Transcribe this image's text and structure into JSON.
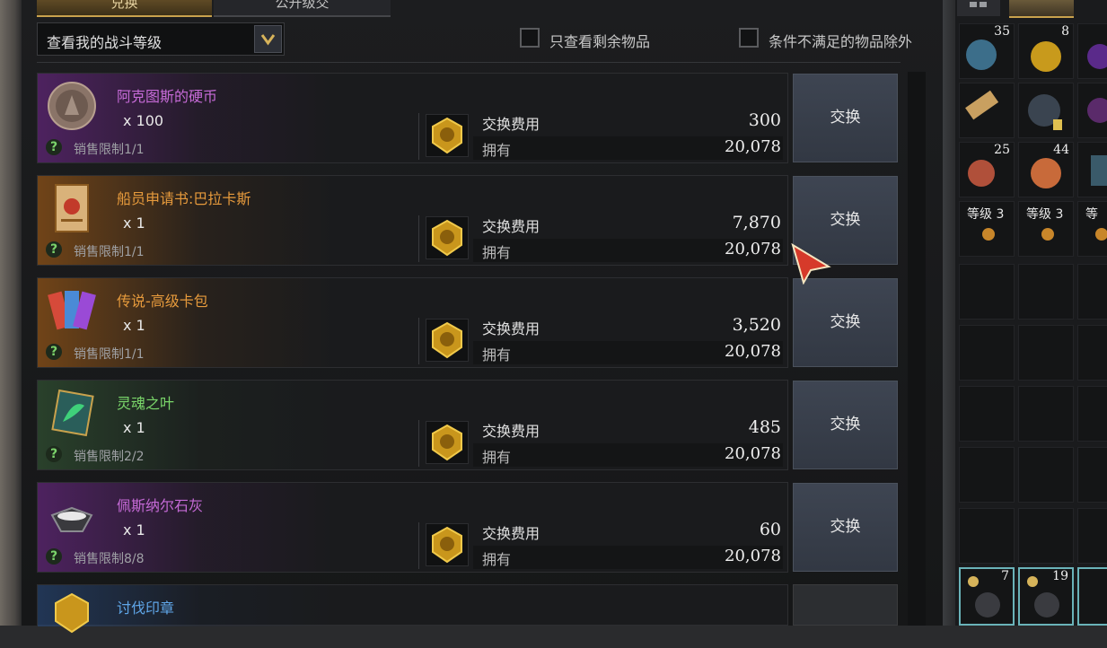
{
  "tabs": [
    {
      "label": "兑换"
    },
    {
      "label": "公开级交"
    }
  ],
  "filter": {
    "dropdown_label": "查看我的战斗等级",
    "checkbox_remaining": "只查看剩余物品",
    "checkbox_exclude": "条件不满足的物品除外"
  },
  "labels": {
    "cost": "交换费用",
    "owned": "拥有",
    "exchange_button": "交换"
  },
  "items": [
    {
      "name": "阿克图斯的硬币",
      "qty": "x 100",
      "limit": "销售限制1/1",
      "cost": "300",
      "owned": "20,078",
      "rarity": "purple"
    },
    {
      "name": "船员申请书:巴拉卡斯",
      "qty": "x 1",
      "limit": "销售限制1/1",
      "cost": "7,870",
      "owned": "20,078",
      "rarity": "orange"
    },
    {
      "name": "传说-高级卡包",
      "qty": "x 1",
      "limit": "销售限制1/1",
      "cost": "3,520",
      "owned": "20,078",
      "rarity": "orange"
    },
    {
      "name": "灵魂之叶",
      "qty": "x 1",
      "limit": "销售限制2/2",
      "cost": "485",
      "owned": "20,078",
      "rarity": "green"
    },
    {
      "name": "佩斯纳尔石灰",
      "qty": "x 1",
      "limit": "销售限制8/8",
      "cost": "60",
      "owned": "20,078",
      "rarity": "purple"
    },
    {
      "name": "讨伐印章",
      "rarity": "blue"
    }
  ],
  "inventory": {
    "counts": [
      "35",
      "8",
      "25",
      "44",
      "7",
      "19"
    ],
    "level_labels": [
      "等级 3",
      "等级 3",
      "等"
    ]
  },
  "colors": {
    "purple": "#c56ad6",
    "orange": "#e69a3c",
    "green": "#7bd86b",
    "blue": "#5fa6e8",
    "button": "#3a404b"
  }
}
